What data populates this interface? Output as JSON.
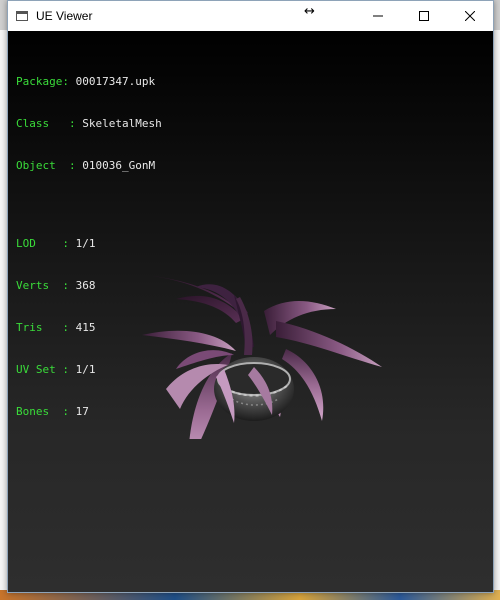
{
  "window": {
    "title": "UE Viewer"
  },
  "info": {
    "package_label": "Package",
    "package_value": "00017347.upk",
    "class_label": "Class",
    "class_value": "SkeletalMesh",
    "object_label": "Object",
    "object_value": "010036_GonM",
    "lod_label": "LOD",
    "lod_value": "1/1",
    "verts_label": "Verts",
    "verts_value": "368",
    "tris_label": "Tris",
    "tris_value": "415",
    "uvset_label": "UV Set",
    "uvset_value": "1/1",
    "bones_label": "Bones",
    "bones_value": "17"
  },
  "colors": {
    "label_green": "#3adc3a",
    "value_white": "#e8e8e8",
    "viewport_top": "#000000",
    "viewport_bottom": "#2e2e2e"
  },
  "icons": {
    "app": "window-app-icon",
    "cursor": "resize-horizontal-icon",
    "minimize": "minimize-icon",
    "maximize": "maximize-icon",
    "close": "close-icon"
  }
}
